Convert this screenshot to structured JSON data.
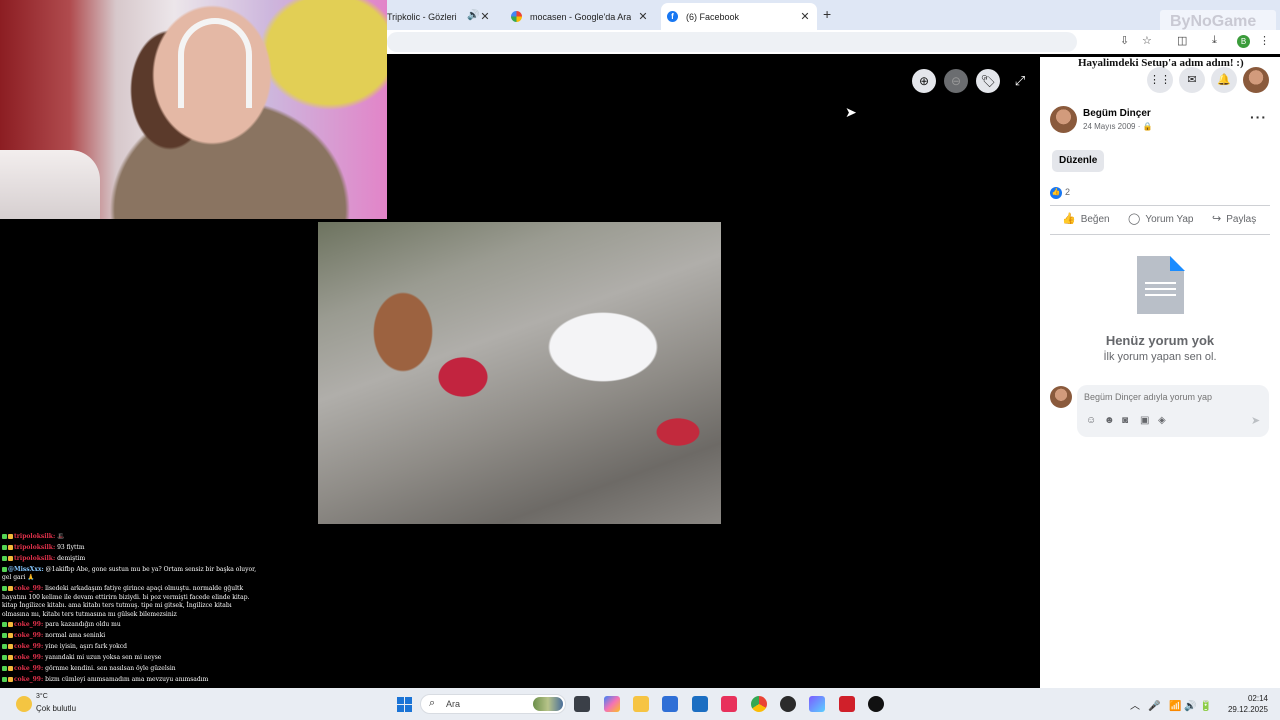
{
  "browser": {
    "tabs": [
      {
        "title": "Tripkolic - Gözlerinin",
        "muted_icon": "speaker-icon"
      },
      {
        "title": "mocasen - Google'da Ara"
      },
      {
        "title": "(6) Facebook"
      }
    ],
    "new_tab_symbol": "+",
    "watermark": "ByNoGame"
  },
  "stream": {
    "title": "Hayalimdeki Setup'a adım adım! :)"
  },
  "viewer": {
    "controls": [
      "zoom-in",
      "zoom-out",
      "tag",
      "fullscreen"
    ]
  },
  "post": {
    "author": "Begüm Dinçer",
    "date": "24 Mayıs 2009 · 🔒",
    "edit_label": "Düzenle",
    "like_count": "2",
    "actions": {
      "like": "Beğen",
      "comment": "Yorum Yap",
      "share": "Paylaş"
    },
    "empty_title": "Henüz yorum yok",
    "empty_subtitle": "İlk yorum yapan sen ol.",
    "comment_placeholder": "Begüm Dinçer adıyla yorum yap"
  },
  "chat": [
    {
      "user": "tripoloksilk:",
      "text": "🎩"
    },
    {
      "user": "tripoloksilk:",
      "text": "93 fiyttm"
    },
    {
      "user": "tripoloksilk:",
      "text": "demiştim"
    },
    {
      "user": "@MissXxx:",
      "text": "@1akifbp Abe, gone sustun mu be ya? Ortam sensiz bir başka oluyor, gel gari 🙏"
    },
    {
      "user": "coke_99:",
      "text": "lisedeki arkadaşım fatiye girince apaçi olmuştu. normalde gğultk hayatını 100 kelime ile devam ettirirn biziydi. bi poz vermişti facede elinde kitap. kitap İngilizce kitabı. ama kitabı ters tutmuş. tipe mi gitsek, İngilizce kitabı olmasına mı, kitabı ters tutmasına mı gülsek bilemezsiniz"
    },
    {
      "user": "coke_99:",
      "text": "para kazandığın oldu mu"
    },
    {
      "user": "coke_99:",
      "text": "normal ama seninki"
    },
    {
      "user": "coke_99:",
      "text": "yine iyisin, aşırı fark yokcd"
    },
    {
      "user": "coke_99:",
      "text": "yanındaki mi uzun yoksa sen mi neyse"
    },
    {
      "user": "coke_99:",
      "text": "görnme kendini. sen nasılsan öyle güzelsin"
    },
    {
      "user": "coke_99:",
      "text": "bizm cümleyi anımsamadım ama mevzuyu anımsadım"
    }
  ],
  "taskbar": {
    "weather_temp": "3°C",
    "weather_desc": "Çok bulutlu",
    "search_placeholder": "Ara",
    "clock_time": "02:14",
    "clock_date": "29.12.2025"
  }
}
